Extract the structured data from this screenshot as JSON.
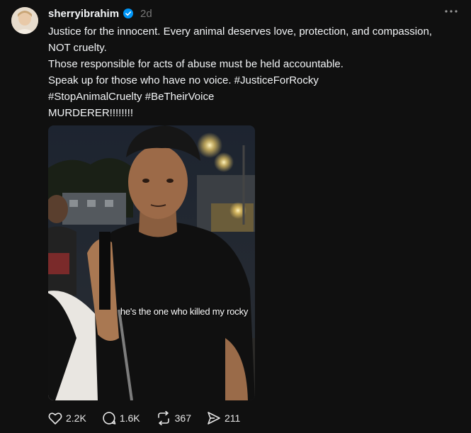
{
  "post": {
    "username": "sherryibrahim",
    "timestamp": "2d",
    "caption": "Justice for the innocent. Every animal deserves love, protection, and compassion, NOT cruelty.\nThose responsible for acts of abuse must be held accountable.\nSpeak up for those who have no voice. #JusticeForRocky\n#StopAnimalCruelty #BeTheirVoice\nMURDERER!!!!!!!!",
    "image_overlay_text": "he's the one who killed my rocky"
  },
  "actions": {
    "likes": "2.2K",
    "replies": "1.6K",
    "reposts": "367",
    "shares": "211"
  },
  "colors": {
    "background": "#101010",
    "text": "#f3f5f7",
    "muted": "#777777",
    "verified": "#0095f6"
  },
  "icons": {
    "verified": "verified-badge-icon",
    "more": "more-dots-icon",
    "like": "heart-icon",
    "reply": "comment-icon",
    "repost": "repost-icon",
    "share": "share-icon"
  }
}
